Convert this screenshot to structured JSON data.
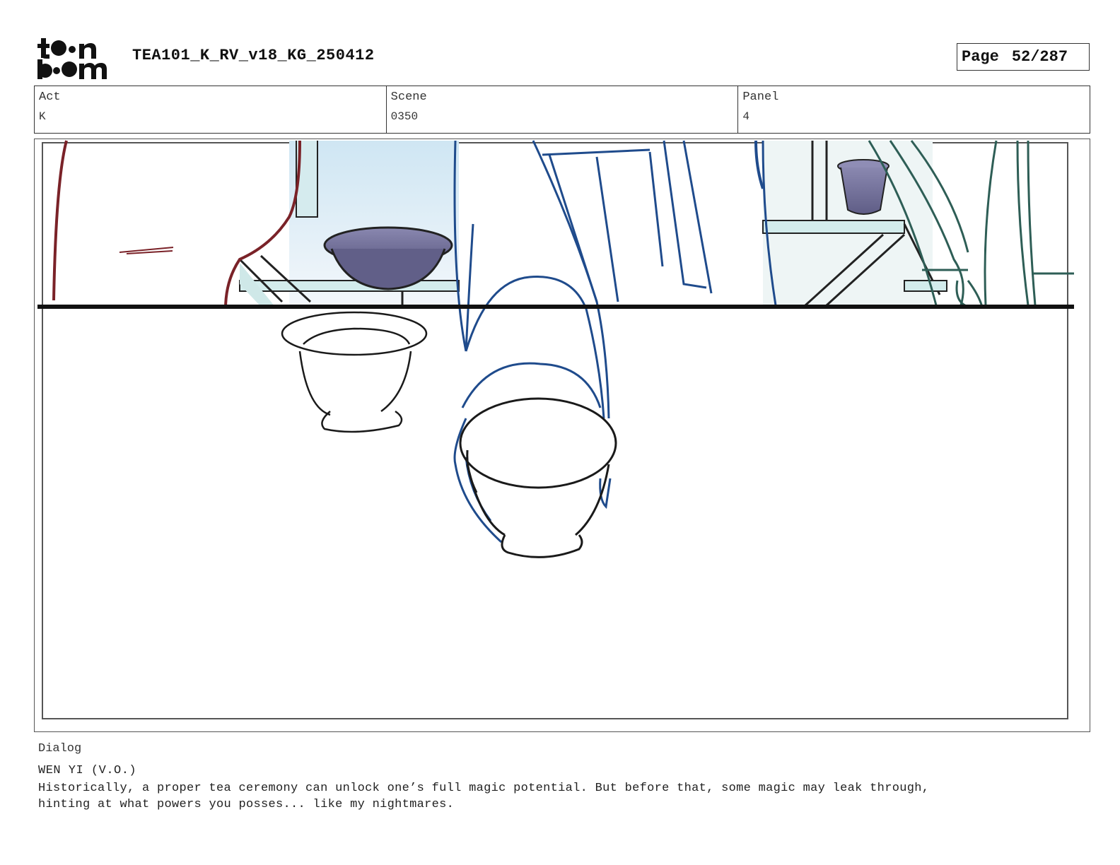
{
  "header": {
    "logo_text_top": "toon",
    "logo_text_bottom": "boom",
    "document_title": "TEA101_K_RV_v18_KG_250412",
    "page_label": "Page",
    "page_number": "52/287"
  },
  "meta": {
    "act_label": "Act",
    "act_value": "K",
    "scene_label": "Scene",
    "scene_value": "0350",
    "panel_label": "Panel",
    "panel_value": "4"
  },
  "panel_image": {
    "icon": "storyboard-sketch-tea-bowls"
  },
  "dialog": {
    "label": "Dialog",
    "speaker": "WEN YI (V.O.)",
    "lines": [
      "Historically, a proper tea ceremony can unlock one’s full magic potential. But before that, some magic may leak through,",
      "hinting at what powers you posses... like my nightmares."
    ]
  }
}
